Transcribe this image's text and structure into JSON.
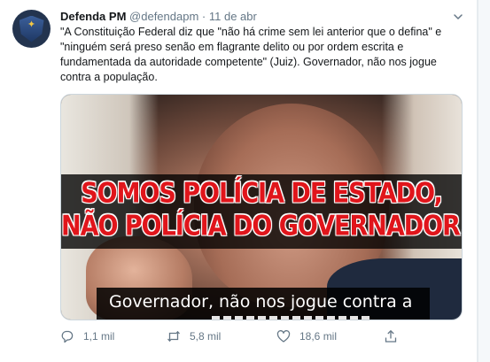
{
  "tweet": {
    "display_name": "Defenda PM",
    "handle": "@defendapm",
    "separator": "·",
    "date": "11 de abr",
    "text": "\"A Constituição Federal diz que \"não há crime sem lei anterior que o defina\" e \"ninguém será preso senão em flagrante delito ou por ordem escrita e fundamentada da autoridade competente\" (Juiz). Governador, não nos jogue contra a população.",
    "avatar_icon": "police-badge-icon",
    "menu_icon": "chevron-down-icon"
  },
  "media": {
    "headline_line1": "SOMOS POLÍCIA DE ESTADO,",
    "headline_line2": "NÃO POLÍCIA DO GOVERNADOR.",
    "subtitle": "Governador, não nos jogue contra a",
    "headline_color": "#e0151b"
  },
  "actions": {
    "reply": {
      "icon": "reply-icon",
      "count": "1,1 mil"
    },
    "retweet": {
      "icon": "retweet-icon",
      "count": "5,8 mil"
    },
    "like": {
      "icon": "heart-icon",
      "count": "18,6 mil"
    },
    "share": {
      "icon": "share-icon"
    }
  },
  "colors": {
    "text": "#14171a",
    "secondary": "#657786",
    "border": "#e6ecf0"
  }
}
